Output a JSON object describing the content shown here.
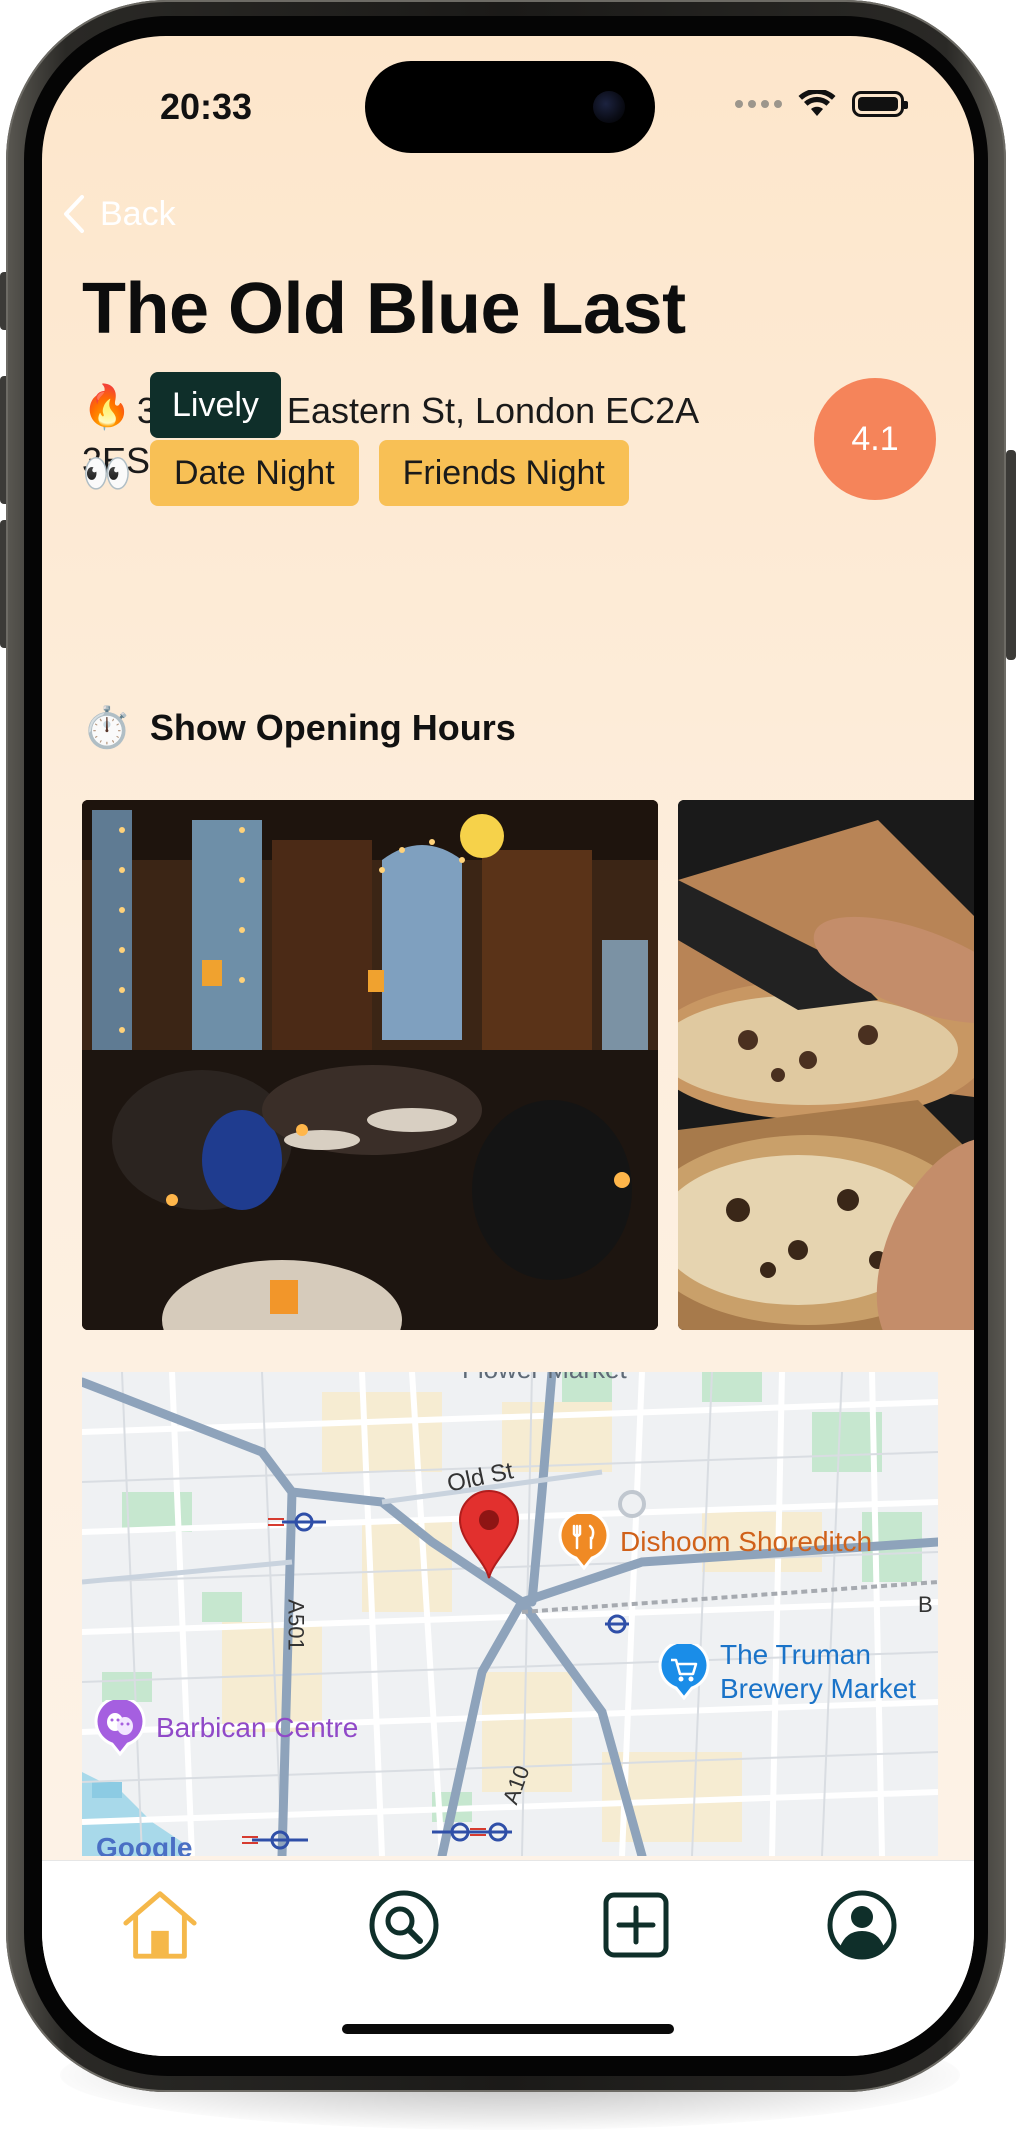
{
  "status_bar": {
    "time": "20:33"
  },
  "nav": {
    "back_label": "Back"
  },
  "venue": {
    "name": "The Old Blue Last",
    "address_emoji": "📍",
    "address": "38 Great Eastern St, London EC2A 3ES, UK",
    "rating": "4.1",
    "vibe_emoji": "🔥",
    "vibe_tags": [
      "Lively"
    ],
    "occasion_emoji": "👀",
    "occasion_tags": [
      "Date Night",
      "Friends Night"
    ],
    "hours_emoji": "⏱️",
    "hours_label": "Show Opening Hours"
  },
  "map": {
    "labels": {
      "old_st": "Old St",
      "dishoom": "Dishoom Shoreditch",
      "truman_line1": "The Truman",
      "truman_line2": "Brewery Market",
      "barbican": "Barbican Centre",
      "a501": "A501",
      "a10": "A10",
      "flower_market": "Flower Market",
      "google": "Google",
      "edge_b": "B"
    }
  },
  "colors": {
    "rating_bg": "#f5845a",
    "tag_dark_bg": "#0f2f2a",
    "tag_yellow_bg": "#f8c055",
    "tab_active": "#f5b84a",
    "tab_inactive": "#0f2f2a"
  },
  "tabbar": {
    "items": [
      {
        "icon": "home-icon",
        "active": true
      },
      {
        "icon": "search-icon",
        "active": false
      },
      {
        "icon": "add-icon",
        "active": false
      },
      {
        "icon": "profile-icon",
        "active": false
      }
    ]
  }
}
